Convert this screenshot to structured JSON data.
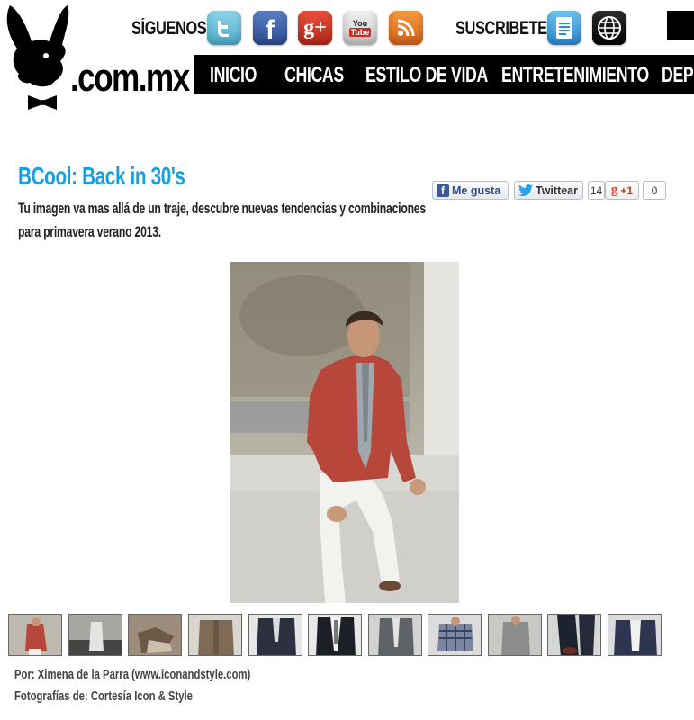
{
  "header": {
    "logo_text": ".com.mx",
    "follow_label": "SÍGUENOS:",
    "subscribe_label": "SUSCRIBETE:",
    "social_icons": [
      "twitter-icon",
      "facebook-icon",
      "google-plus-icon",
      "youtube-icon",
      "rss-icon"
    ],
    "subscribe_icons": [
      "newsletter-icon",
      "globe-icon"
    ],
    "youtube_text_top": "You",
    "youtube_text_bottom": "Tube",
    "google_plus_text": "g+",
    "facebook_text": "f"
  },
  "nav": {
    "items": [
      "INICIO",
      "CHICAS",
      "ESTILO DE VIDA",
      "ENTRETENIMIENTO",
      "DEPO"
    ]
  },
  "article": {
    "title": "BCool: Back in 30's",
    "subtitle": "Tu imagen va mas allá de un traje, descubre nuevas tendencias y combinaciones para primavera verano 2013.",
    "credit_author": "Por: Ximena de la Parra (www.iconandstyle.com)",
    "credit_photos": "Fotografías de: Cortesía Icon & Style"
  },
  "share": {
    "facebook_label": "Me gusta",
    "twitter_label": "Twittear",
    "plus_count": "14",
    "plus_label": "+1",
    "zero_count": "0"
  },
  "colors": {
    "title": "#1a9ee0",
    "nav_bg": "#000000",
    "jacket": "#b8473b"
  },
  "gallery": {
    "thumb_count": 11
  }
}
